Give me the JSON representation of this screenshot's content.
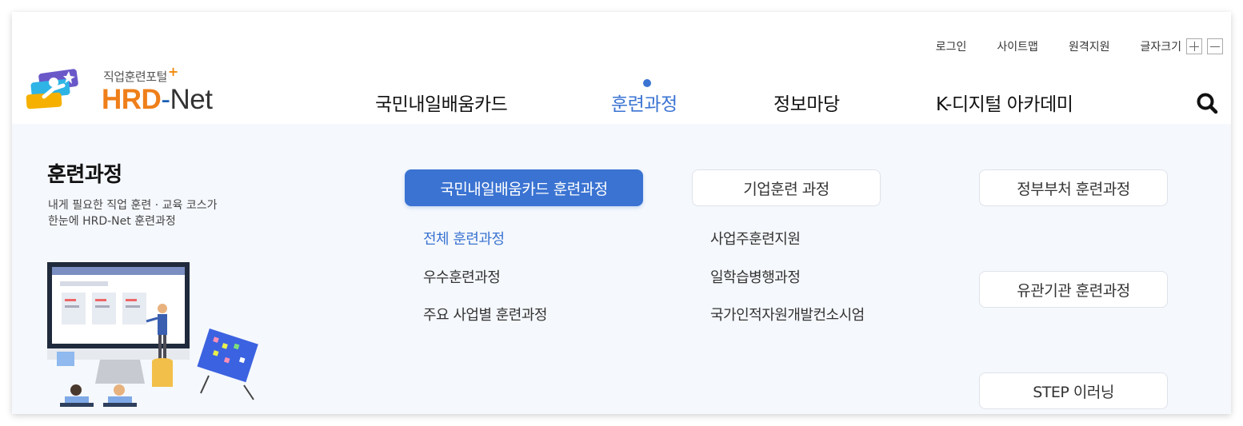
{
  "util": {
    "login": "로그인",
    "sitemap": "사이트맵",
    "remote": "원격지원",
    "font_size_label": "글자크기"
  },
  "logo": {
    "sub": "직업훈련포털",
    "plus": "+",
    "hrd": "HRD",
    "dash": "-",
    "net": "Net"
  },
  "gnb": {
    "items": [
      "국민내일배움카드",
      "훈련과정",
      "정보마당",
      "K-디지털 아카데미"
    ],
    "active": "훈련과정"
  },
  "mega": {
    "title": "훈련과정",
    "desc_line1": "내게 필요한 직업 훈련 · 교육 코스가",
    "desc_line2": "한눈에 HRD-Net 훈련과정",
    "col1": {
      "header": "국민내일배움카드 훈련과정",
      "links": [
        "전체 훈련과정",
        "우수훈련과정",
        "주요 사업별 훈련과정"
      ]
    },
    "col2": {
      "header": "기업훈련 과정",
      "links": [
        "사업주훈련지원",
        "일학습병행과정",
        "국가인적자원개발컨소시엄"
      ]
    },
    "col3": {
      "items": [
        "정부부처 훈련과정",
        "유관기관 훈련과정",
        "STEP 이러닝"
      ]
    }
  },
  "colors": {
    "accent": "#3a73d2",
    "logo_orange": "#ef7f1a",
    "mega_bg": "#f5f8fc"
  },
  "icons": {
    "search": "search-icon",
    "font_plus": "plus-icon",
    "font_minus": "minus-icon"
  }
}
